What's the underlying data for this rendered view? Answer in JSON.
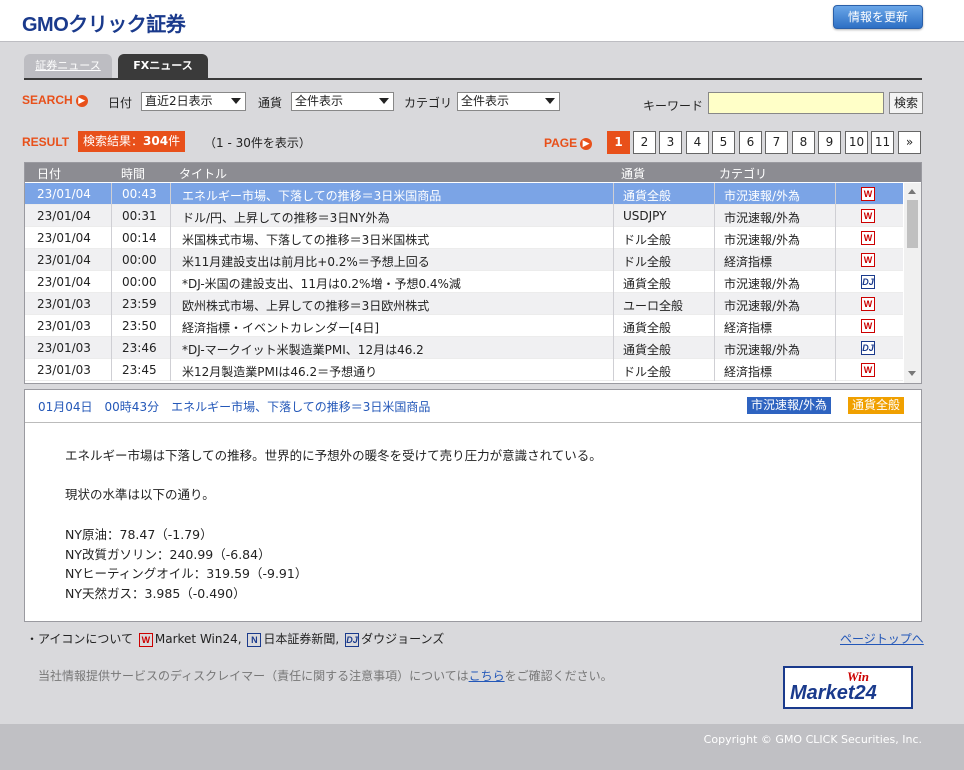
{
  "header": {
    "logo_text": "GMOクリック証券",
    "refresh_button": "情報を更新"
  },
  "tabs": [
    {
      "label": "証券ニュース",
      "active": false
    },
    {
      "label": "FXニュース",
      "active": true
    }
  ],
  "search": {
    "label": "SEARCH",
    "date_label": "日付",
    "date_value": "直近2日表示",
    "currency_label": "通貨",
    "currency_value": "全件表示",
    "category_label": "カテゴリ",
    "category_value": "全件表示",
    "keyword_label": "キーワード",
    "keyword_value": "",
    "search_button": "検索"
  },
  "result": {
    "label": "RESULT",
    "count_prefix": "検索結果：",
    "count": "304",
    "count_suffix": "件",
    "range_text": "（1 - 30件を表示）"
  },
  "pager": {
    "label": "PAGE",
    "pages": [
      "1",
      "2",
      "3",
      "4",
      "5",
      "6",
      "7",
      "8",
      "9",
      "10",
      "11"
    ],
    "current": "1",
    "next": "»"
  },
  "table": {
    "headers": {
      "date": "日付",
      "time": "時間",
      "title": "タイトル",
      "currency": "通貨",
      "category": "カテゴリ"
    },
    "rows": [
      {
        "date": "23/01/04",
        "time": "00:43",
        "title": "エネルギー市場、下落しての推移＝3日米国商品",
        "currency": "通貨全般",
        "category": "市況速報/外為",
        "source": "W"
      },
      {
        "date": "23/01/04",
        "time": "00:31",
        "title": "ドル/円、上昇しての推移＝3日NY外為",
        "currency": "USDJPY",
        "category": "市況速報/外為",
        "source": "W"
      },
      {
        "date": "23/01/04",
        "time": "00:14",
        "title": "米国株式市場、下落しての推移＝3日米国株式",
        "currency": "ドル全般",
        "category": "市況速報/外為",
        "source": "W"
      },
      {
        "date": "23/01/04",
        "time": "00:00",
        "title": "米11月建設支出は前月比+0.2%＝予想上回る",
        "currency": "ドル全般",
        "category": "経済指標",
        "source": "W"
      },
      {
        "date": "23/01/04",
        "time": "00:00",
        "title": "*DJ-米国の建設支出、11月は0.2%増・予想0.4%減",
        "currency": "通貨全般",
        "category": "市況速報/外為",
        "source": "DJ"
      },
      {
        "date": "23/01/03",
        "time": "23:59",
        "title": "欧州株式市場、上昇しての推移＝3日欧州株式",
        "currency": "ユーロ全般",
        "category": "市況速報/外為",
        "source": "W"
      },
      {
        "date": "23/01/03",
        "time": "23:50",
        "title": "経済指標・イベントカレンダー[4日]",
        "currency": "通貨全般",
        "category": "経済指標",
        "source": "W"
      },
      {
        "date": "23/01/03",
        "time": "23:46",
        "title": "*DJ-マークイット米製造業PMI、12月は46.2",
        "currency": "通貨全般",
        "category": "市況速報/外為",
        "source": "DJ"
      },
      {
        "date": "23/01/03",
        "time": "23:45",
        "title": "米12月製造業PMIは46.2＝予想通り",
        "currency": "ドル全般",
        "category": "経済指標",
        "source": "W"
      }
    ]
  },
  "detail": {
    "header": "01月04日　00時43分　エネルギー市場、下落しての推移＝3日米国商品",
    "tag_category": "市況速報/外為",
    "tag_currency": "通貨全般",
    "lines": [
      "エネルギー市場は下落しての推移。世界的に予想外の暖冬を受けて売り圧力が意識されている。",
      "現状の水準は以下の通り。",
      "NY原油：78.47（-1.79）",
      "NY改質ガソリン：240.99（-6.84）",
      "NYヒーティングオイル：319.59（-9.91）",
      "NY天然ガス：3.985（-0.490）"
    ]
  },
  "legend": {
    "prefix": "・アイコンについて",
    "w_label": "Market Win24,",
    "n_label": "日本証券新聞,",
    "dj_label": "ダウジョーンズ",
    "page_top": "ページトップへ"
  },
  "disclaimer": {
    "before": "当社情報提供サービスのディスクレイマー（責任に関する注意事項）については",
    "link": "こちら",
    "after": "をご確認ください。"
  },
  "marketwin_logo": {
    "win": "Win",
    "market": "Market24"
  },
  "footer": {
    "copyright": "Copyright © GMO CLICK Securities, Inc."
  },
  "colors": {
    "accent": "#e8501a",
    "link": "#2357b8",
    "selected_row": "#7ba4e6"
  }
}
